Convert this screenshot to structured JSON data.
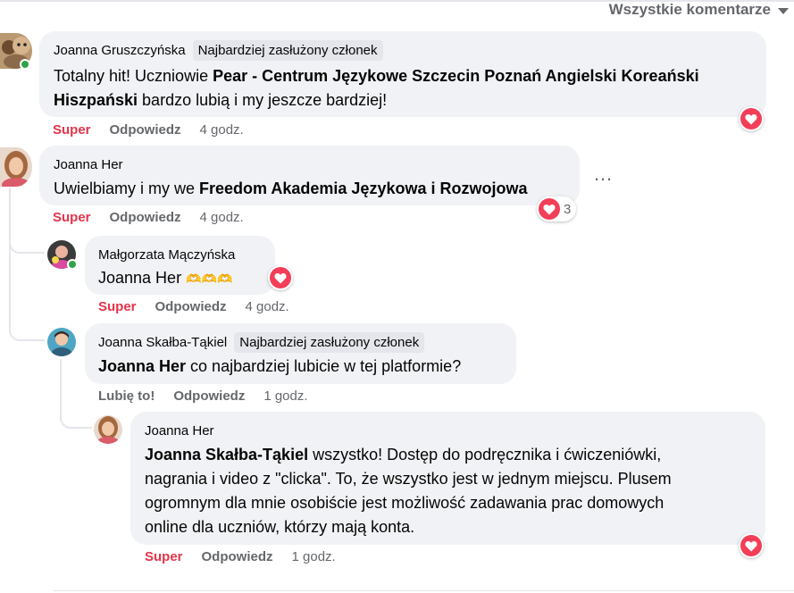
{
  "header": {
    "filter_label": "Wszystkie komentarze"
  },
  "comments": [
    {
      "author": "Joanna Gruszczyńska",
      "badge": "Najbardziej zasłużony członek",
      "text_parts": [
        "Totalny hit! Uczniowie ",
        "Pear - Centrum Językowe Szczecin Poznań Angielski Koreański Hiszpański",
        " bardzo lubią i my jeszcze bardziej!"
      ],
      "actions": {
        "react": "Super",
        "reply": "Odpowiedz",
        "time": "4 godz."
      },
      "reactions": {
        "icon": "heart-icon",
        "count": ""
      }
    },
    {
      "author": "Joanna Her",
      "text_parts": [
        "Uwielbiamy i my we ",
        "Freedom Akademia Językowa i Rozwojowa"
      ],
      "more_icon": "…",
      "actions": {
        "react": "Super",
        "reply": "Odpowiedz",
        "time": "4 godz."
      },
      "reactions": {
        "icon": "heart-icon",
        "count": "3"
      },
      "replies": [
        {
          "author": "Małgorzata Mączyńska",
          "mention": "Joanna Her",
          "emoji": "🫶🫶🫶",
          "actions": {
            "react": "Super",
            "reply": "Odpowiedz",
            "time": "4 godz."
          },
          "reactions": {
            "icon": "heart-icon",
            "count": ""
          }
        },
        {
          "author": "Joanna Skałba-Tąkiel",
          "badge": "Najbardziej zasłużony członek",
          "mention": "Joanna Her",
          "text": " co najbardziej lubicie w tej platformie?",
          "actions": {
            "react": "Lubię to!",
            "reply": "Odpowiedz",
            "time": "1 godz."
          }
        },
        {
          "author": "Joanna Her",
          "mention": "Joanna Skałba-Tąkiel",
          "lines": [
            " wszystko! Dostęp do podręcznika i ćwiczeniówki,",
            "nagrania i video z \"clicka\". To, że wszystko jest w jednym miejscu. Plusem",
            "ogromnym dla mnie osobiście jest możliwość zadawania prac domowych",
            "online dla uczniów, którzy mają konta."
          ],
          "actions": {
            "react": "Super",
            "reply": "Odpowiedz",
            "time": "1 godz."
          },
          "reactions": {
            "icon": "heart-icon",
            "count": ""
          }
        }
      ]
    }
  ],
  "colors": {
    "bubble": "#f0f2f5",
    "super": "#e4344b",
    "heart": "#f33e58",
    "meta": "#65676b",
    "online": "#31a24c"
  }
}
